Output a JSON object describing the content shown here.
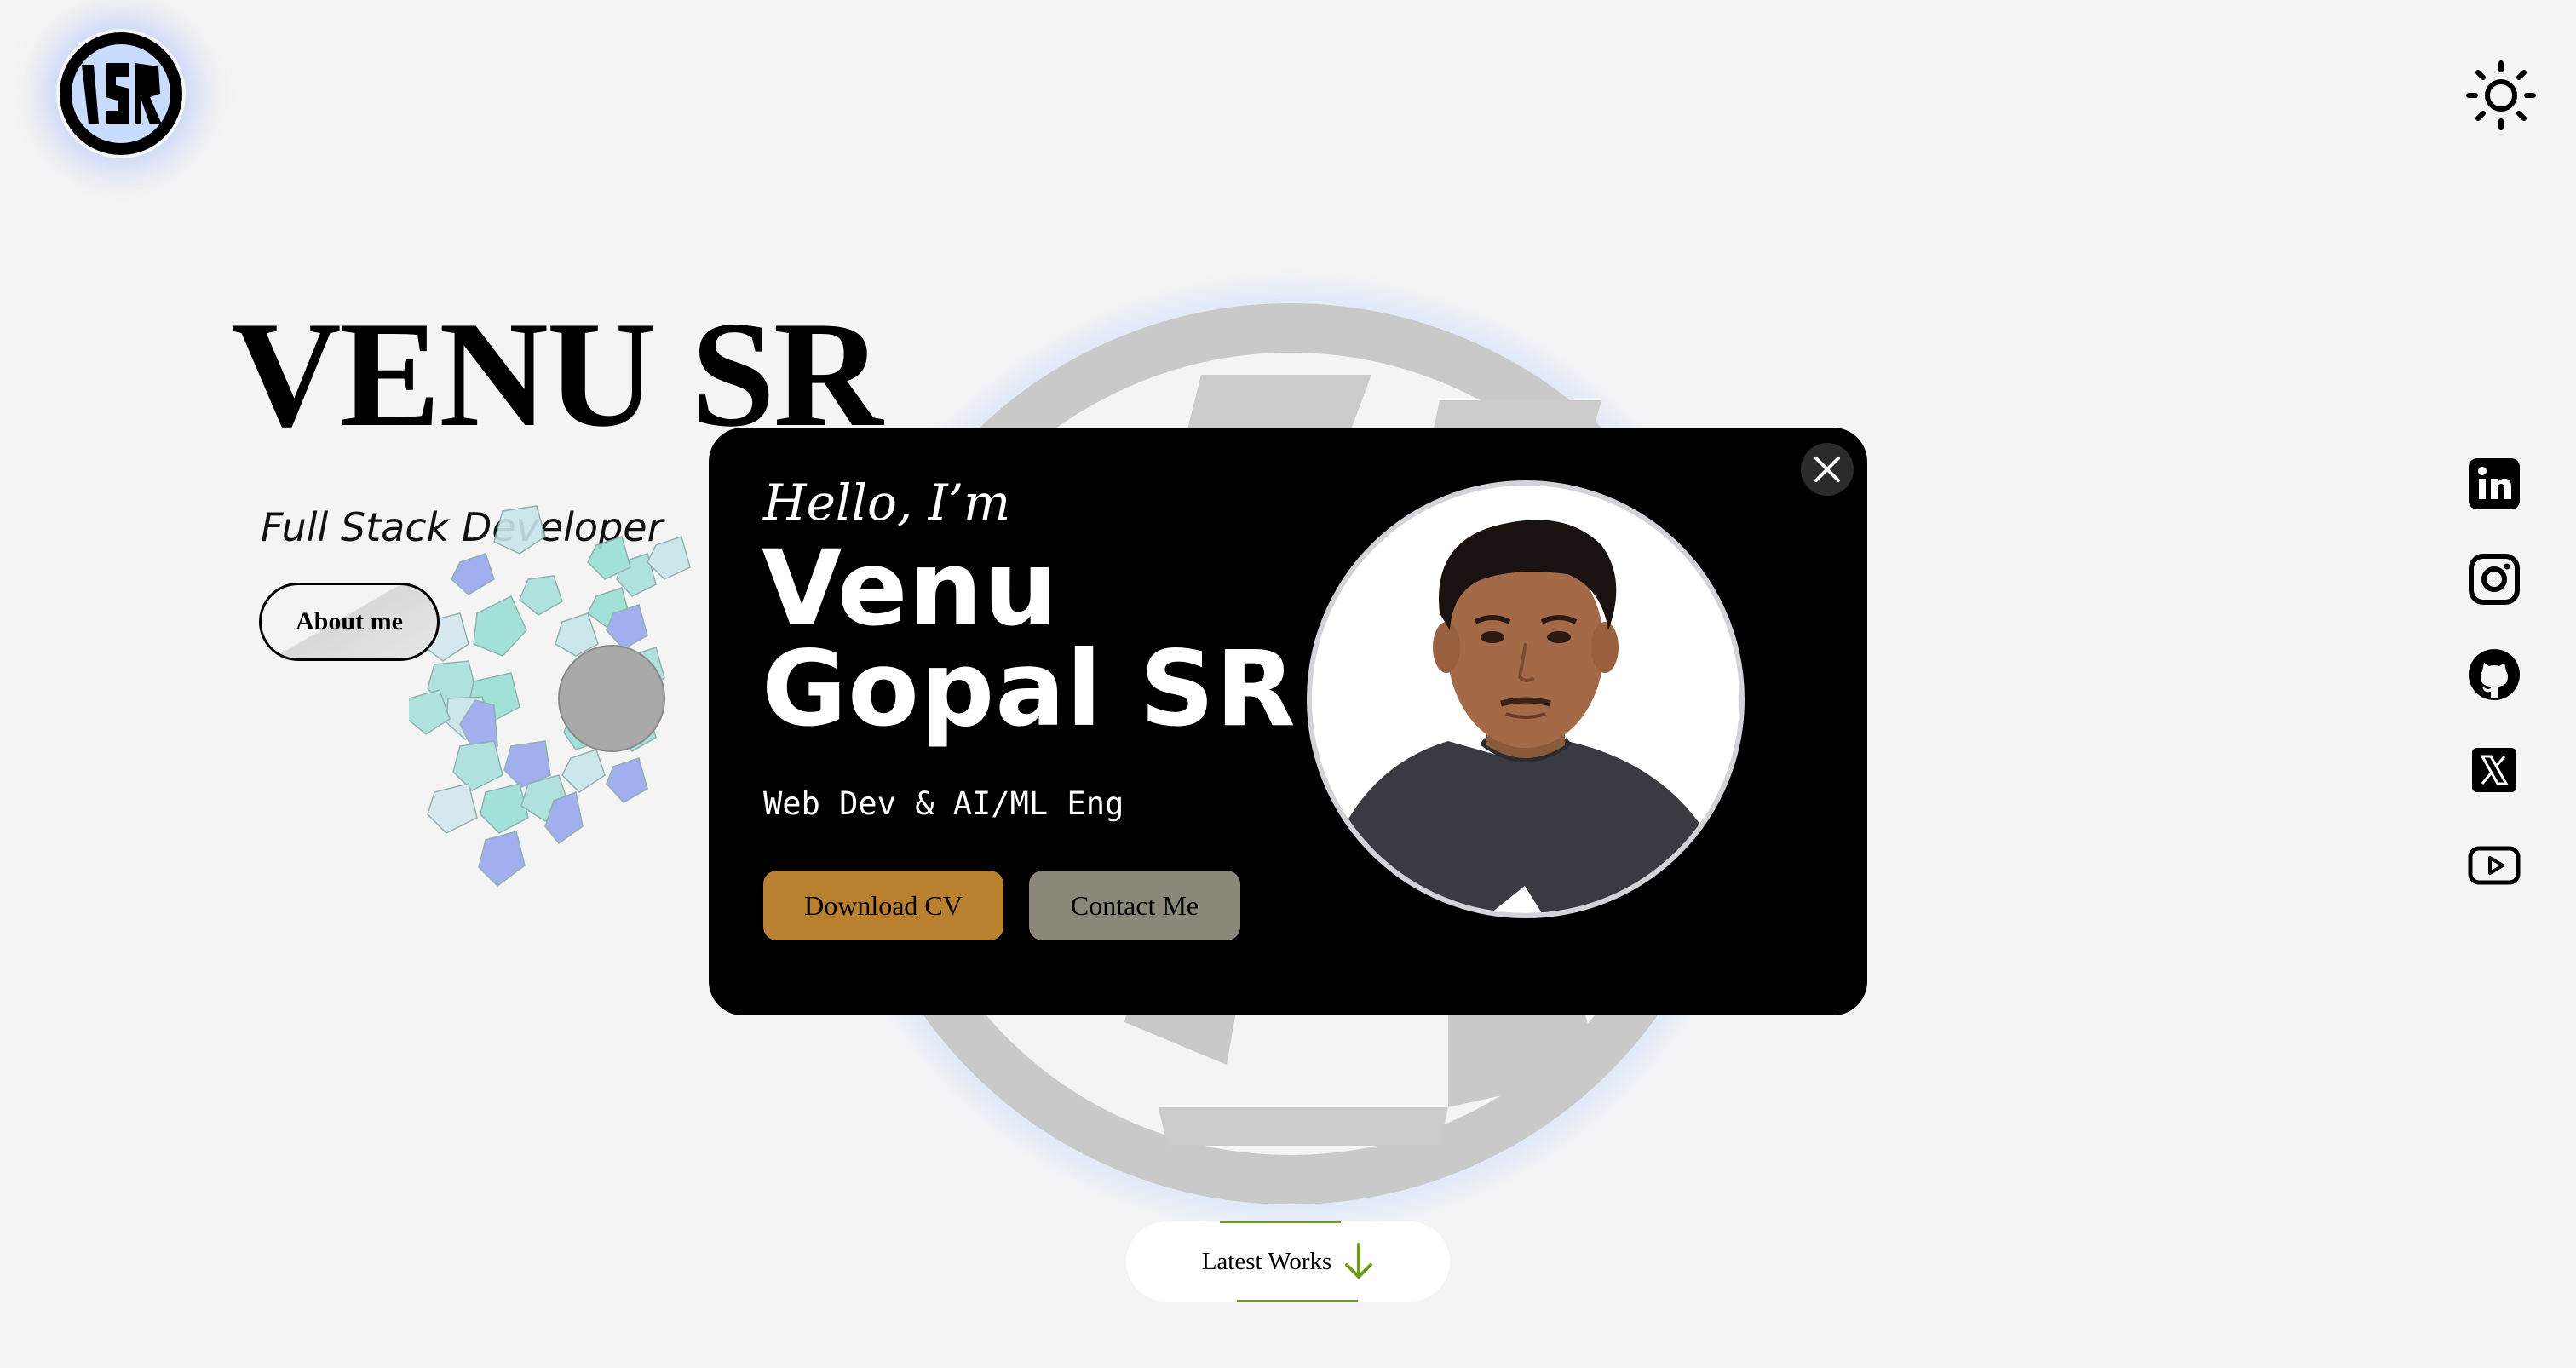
{
  "header": {
    "logo_text": "VSR",
    "theme_toggle_icon": "sun-icon"
  },
  "hero": {
    "name": "VENU SR",
    "role": "Full Stack Developer",
    "about_label": "About me"
  },
  "modal": {
    "greeting": "Hello, I’m",
    "name_line1": "Venu",
    "name_line2": "Gopal SR",
    "tagline": "Web Dev & AI/ML Eng",
    "download_label": "Download CV",
    "contact_label": "Contact Me",
    "close_icon": "close-icon"
  },
  "social": [
    "linkedin-icon",
    "instagram-icon",
    "github-icon",
    "x-icon",
    "youtube-icon"
  ],
  "footer": {
    "latest_label": "Latest Works",
    "arrow_icon": "arrow-down-icon"
  },
  "colors": {
    "background": "#f4f4f4",
    "modal_bg": "#000000",
    "download_btn": "#b8802f",
    "contact_btn": "#8b887a",
    "accent_green": "#6b9d1a"
  }
}
